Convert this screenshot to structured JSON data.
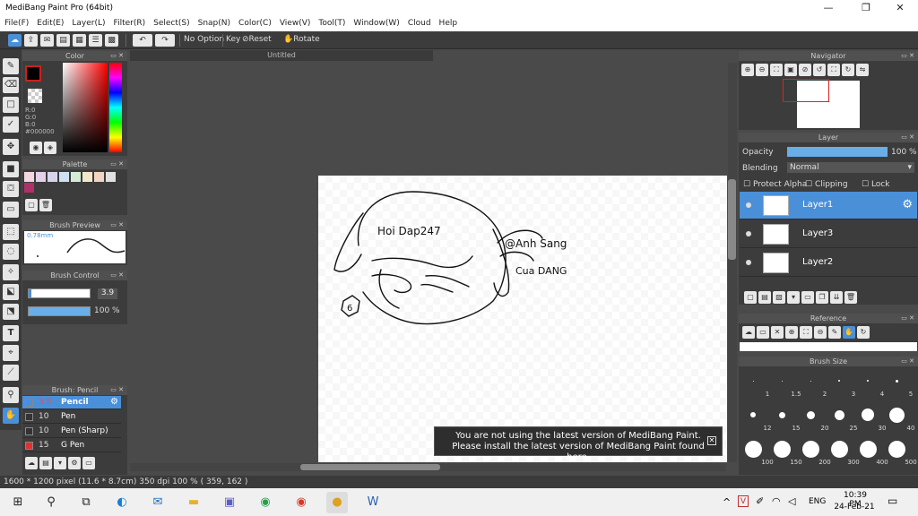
{
  "title": "MediBang Paint Pro (64bit)",
  "window_controls": {
    "minimize": "—",
    "maximize": "❐",
    "close": "✕"
  },
  "menu": [
    "File(F)",
    "Edit(E)",
    "Layer(L)",
    "Filter(R)",
    "Select(S)",
    "Snap(N)",
    "Color(C)",
    "View(V)",
    "Tool(T)",
    "Window(W)",
    "Cloud",
    "Help"
  ],
  "toolbar": {
    "snap": "No Option",
    "key": "Key",
    "reset": "Reset",
    "rotate": "Rotate"
  },
  "panels": {
    "color": "Color",
    "palette": "Palette",
    "brush_preview": "Brush Preview",
    "brush_control": "Brush Control",
    "brush_list": "Brush: Pencil",
    "navigator": "Navigator",
    "layer": "Layer",
    "reference": "Reference",
    "brush_size": "Brush Size"
  },
  "color": {
    "r": "R:0",
    "g": "G:0",
    "b": "B:0",
    "hex": "#000000",
    "fg": "#000000",
    "accent": "#4a90d9"
  },
  "palette_colors": [
    "#f4d6e0",
    "#e6cfe8",
    "#d6d4ec",
    "#cfe0f0",
    "#d4ecd6",
    "#f0e8c8",
    "#f0d4c4",
    "#e0e0e0",
    "#b0306a"
  ],
  "brush_preview_size": "0.78mm",
  "brush_control": {
    "size": "3.9",
    "opacity": "100 %",
    "size_fraction": 0.58,
    "opacity_fraction": 1.0
  },
  "brushes": [
    {
      "size": "3.9",
      "name": "Pencil",
      "color": "#4a90d9",
      "selected": true
    },
    {
      "size": "10",
      "name": "Pen",
      "color": "#333333",
      "selected": false
    },
    {
      "size": "10",
      "name": "Pen (Sharp)",
      "color": "#333333",
      "selected": false
    },
    {
      "size": "15",
      "name": "G Pen",
      "color": "#e03030",
      "selected": false
    }
  ],
  "document": {
    "tab": "Untitled"
  },
  "drawing_text": {
    "line1": "Hoi Dap247",
    "line2": "@Anh Sang",
    "line3": "Cua DANG",
    "badge": "6"
  },
  "layer": {
    "opacity_label": "Opacity",
    "opacity_value": "100 %",
    "opacity_fraction": 1.0,
    "blending_label": "Blending",
    "blending_value": "Normal",
    "protect_alpha": "Protect Alpha",
    "clipping": "Clipping",
    "lock": "Lock",
    "items": [
      {
        "name": "Layer1",
        "selected": true
      },
      {
        "name": "Layer3",
        "selected": false
      },
      {
        "name": "Layer2",
        "selected": false
      }
    ]
  },
  "brush_sizes": [
    {
      "label": "1",
      "d": 1
    },
    {
      "label": "1.5",
      "d": 1
    },
    {
      "label": "2",
      "d": 1
    },
    {
      "label": "3",
      "d": 2
    },
    {
      "label": "4",
      "d": 2
    },
    {
      "label": "5",
      "d": 3
    },
    {
      "label": "12",
      "d": 6
    },
    {
      "label": "15",
      "d": 7
    },
    {
      "label": "20",
      "d": 9
    },
    {
      "label": "25",
      "d": 11
    },
    {
      "label": "30",
      "d": 14
    },
    {
      "label": "40",
      "d": 17
    },
    {
      "label": "100",
      "d": 19
    },
    {
      "label": "150",
      "d": 19
    },
    {
      "label": "200",
      "d": 19
    },
    {
      "label": "300",
      "d": 19
    },
    {
      "label": "400",
      "d": 19
    },
    {
      "label": "500",
      "d": 19
    }
  ],
  "notice": {
    "line1": "You are not using the latest version of MediBang Paint.",
    "line2": "Please install the latest version of MediBang Paint found here.",
    "close": "✕"
  },
  "statusbar": {
    "size": "1600 * 1200 pixel",
    "physical": "(11.6 * 8.7cm)",
    "dpi": "350 dpi",
    "zoom": "100 %",
    "coords": "( 359, 162 )"
  },
  "taskbar": {
    "time": "10:39 PM",
    "date": "24-Feb-21",
    "lang": "ENG",
    "tray_arrow": "^"
  }
}
